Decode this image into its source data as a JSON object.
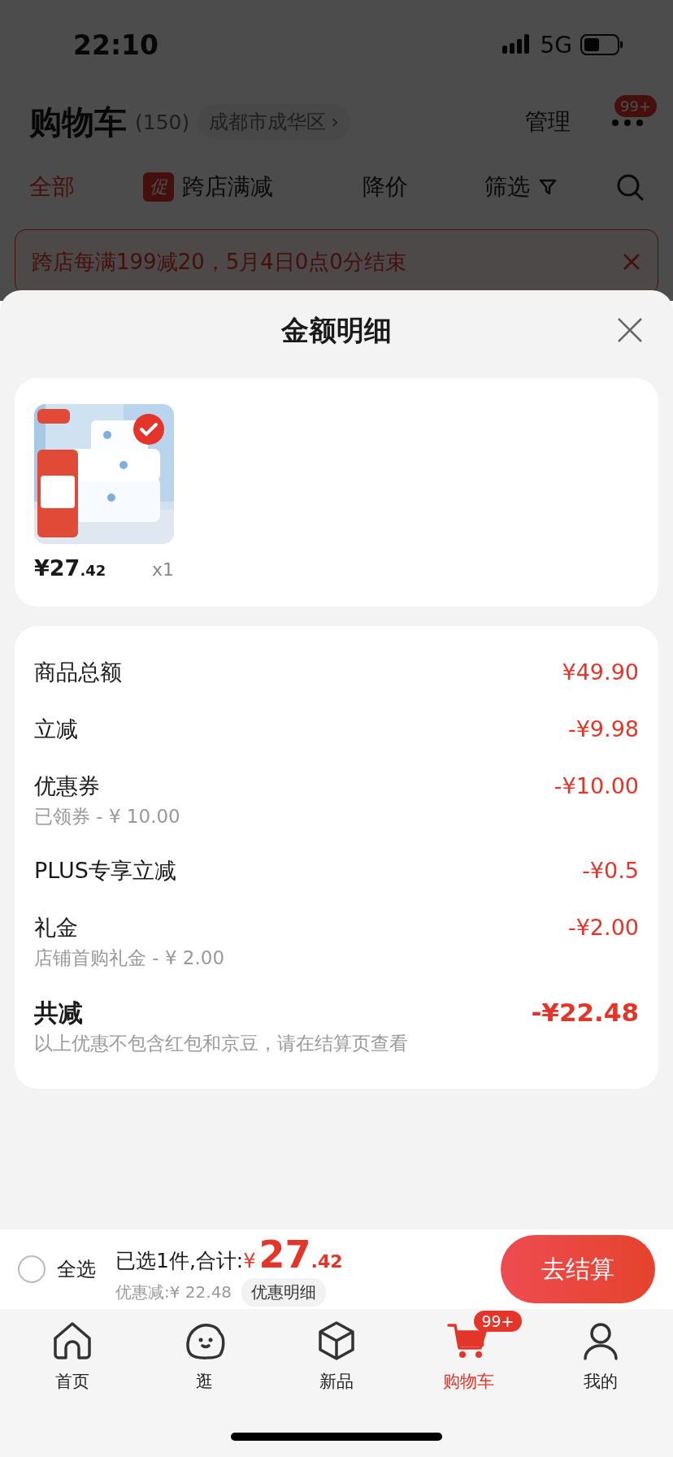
{
  "status_bar": {
    "time": "22:10",
    "network": "5G"
  },
  "header": {
    "title": "购物车",
    "count": "(150)",
    "location": "成都市成华区",
    "location_chevron": "›",
    "manage": "管理",
    "more_badge": "99+"
  },
  "filters": [
    {
      "label": "全部",
      "selected": true,
      "kind": "plain"
    },
    {
      "label": "跨店满减",
      "selected": false,
      "kind": "promo",
      "tag": "促"
    },
    {
      "label": "降价",
      "selected": false,
      "kind": "plain"
    },
    {
      "label": "筛选",
      "selected": false,
      "kind": "filter"
    }
  ],
  "banner": {
    "text": "跨店每满199减20，5月4日0点0分结束"
  },
  "sheet": {
    "title": "金额明细",
    "products": [
      {
        "kind": "picture",
        "checked": true,
        "price_main": "¥27",
        "price_decimal": ".42",
        "quantity": "x1"
      }
    ],
    "lines": [
      {
        "label": "商品总额",
        "amount": "¥49.90"
      },
      {
        "label": "立减",
        "amount": "-¥9.98"
      },
      {
        "label": "优惠券",
        "amount": "-¥10.00",
        "note": "已领券 - ¥ 10.00"
      },
      {
        "label": "PLUS专享立减",
        "amount": "-¥0.5"
      },
      {
        "label": "礼金",
        "amount": "-¥2.00",
        "note": "店铺首购礼金 - ¥ 2.00"
      }
    ],
    "total": {
      "label": "共减",
      "amount": "-¥22.48",
      "note": "以上优惠不包含红包和京豆，请在结算页查看"
    }
  },
  "checkout": {
    "select_all": {
      "label": "全选",
      "checked": false
    },
    "summary": "已选1件,合计:",
    "currency": "¥",
    "price_main": "27",
    "price_decimal": ".42",
    "discount": "优惠减:¥ 22.48",
    "detail_link": "优惠明细",
    "button": "去结算"
  },
  "tab_bar": [
    {
      "label": "首页",
      "selected": false,
      "kind": "home"
    },
    {
      "label": "逛",
      "selected": false,
      "kind": "stroll"
    },
    {
      "label": "新品",
      "selected": false,
      "kind": "new"
    },
    {
      "label": "购物车",
      "selected": true,
      "kind": "cart",
      "badge": "99+"
    },
    {
      "label": "我的",
      "selected": false,
      "kind": "me"
    }
  ]
}
